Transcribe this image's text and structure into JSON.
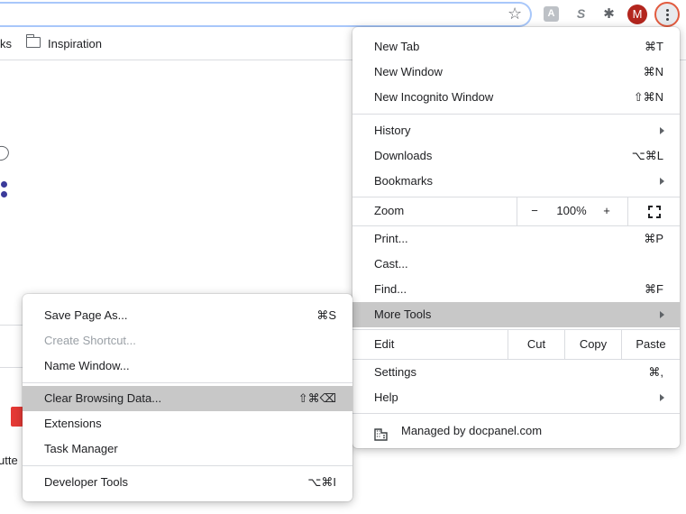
{
  "toolbar": {
    "bookmark_star_icon": "star-outline-icon",
    "extensions": [
      "translate-extension-icon",
      "s-extension-icon",
      "puzzle-extensions-icon"
    ],
    "s_extension_glyph": "S",
    "avatar_initial": "M",
    "menu_icon": "kebab-menu-icon"
  },
  "bookmarks_bar": {
    "partial_item": "ks",
    "folder_label": "Inspiration"
  },
  "page": {
    "partial_text": "utte"
  },
  "chrome_menu": {
    "new_tab": {
      "label": "New Tab",
      "shortcut": "⌘T"
    },
    "new_window": {
      "label": "New Window",
      "shortcut": "⌘N"
    },
    "new_incognito": {
      "label": "New Incognito Window",
      "shortcut": "⇧⌘N"
    },
    "history": {
      "label": "History"
    },
    "downloads": {
      "label": "Downloads",
      "shortcut": "⌥⌘L"
    },
    "bookmarks": {
      "label": "Bookmarks"
    },
    "zoom": {
      "label": "Zoom",
      "minus": "−",
      "value": "100%",
      "plus": "+"
    },
    "print": {
      "label": "Print...",
      "shortcut": "⌘P"
    },
    "cast": {
      "label": "Cast..."
    },
    "find": {
      "label": "Find...",
      "shortcut": "⌘F"
    },
    "more_tools": {
      "label": "More Tools"
    },
    "edit": {
      "label": "Edit",
      "cut": "Cut",
      "copy": "Copy",
      "paste": "Paste"
    },
    "settings": {
      "label": "Settings",
      "shortcut": "⌘,"
    },
    "help": {
      "label": "Help"
    },
    "managed": {
      "label": "Managed by docpanel.com"
    }
  },
  "more_tools_menu": {
    "save_page": {
      "label": "Save Page As...",
      "shortcut": "⌘S"
    },
    "create_shortcut": {
      "label": "Create Shortcut..."
    },
    "name_window": {
      "label": "Name Window..."
    },
    "clear_data": {
      "label": "Clear Browsing Data...",
      "shortcut": "⇧⌘⌫"
    },
    "extensions": {
      "label": "Extensions"
    },
    "task_manager": {
      "label": "Task Manager"
    },
    "developer_tools": {
      "label": "Developer Tools",
      "shortcut": "⌥⌘I"
    }
  },
  "colors": {
    "highlight": "#c8c8c8",
    "avatar": "#b3261e",
    "focus_ring": "#e25b3f"
  }
}
